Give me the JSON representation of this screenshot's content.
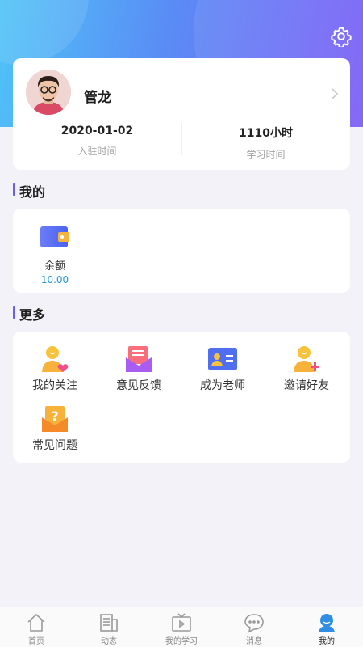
{
  "header": {
    "settings_icon": "gear-icon",
    "gradient_from": "#4fc3f7",
    "gradient_to": "#7b5cf6"
  },
  "profile": {
    "name": "管龙",
    "join_date": "2020-01-02",
    "join_label": "入驻时间",
    "study_time": "1110小时",
    "study_label": "学习时间"
  },
  "mine": {
    "title": "我的",
    "items": [
      {
        "label": "余额",
        "value": "10.00",
        "icon": "wallet-icon"
      }
    ]
  },
  "more": {
    "title": "更多",
    "items": [
      {
        "label": "我的关注",
        "icon": "follow-icon"
      },
      {
        "label": "意见反馈",
        "icon": "feedback-icon"
      },
      {
        "label": "成为老师",
        "icon": "teacher-icon"
      },
      {
        "label": "邀请好友",
        "icon": "invite-icon"
      },
      {
        "label": "常见问题",
        "icon": "faq-icon"
      }
    ]
  },
  "tabbar": {
    "active_color": "#2196d8",
    "items": [
      {
        "label": "首页",
        "icon": "home-icon"
      },
      {
        "label": "动态",
        "icon": "news-icon"
      },
      {
        "label": "我的学习",
        "icon": "tv-icon"
      },
      {
        "label": "消息",
        "icon": "chat-icon"
      },
      {
        "label": "我的",
        "icon": "profile-icon",
        "active": true
      }
    ]
  }
}
